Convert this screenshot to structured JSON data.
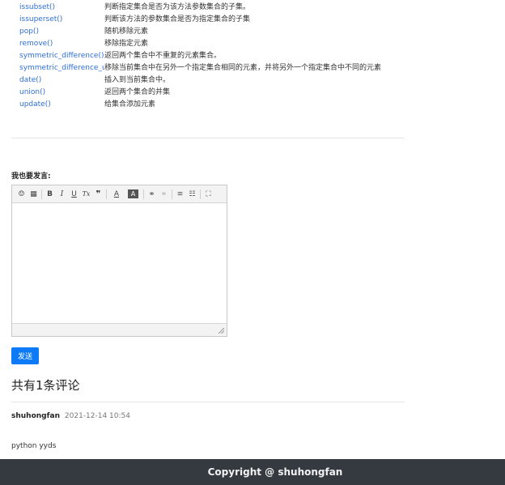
{
  "methods": [
    {
      "name": "issubset()",
      "desc": "判断指定集合是否为该方法参数集合的子集。"
    },
    {
      "name": "issuperset()",
      "desc": "判断该方法的参数集合是否为指定集合的子集"
    },
    {
      "name": "pop()",
      "desc": "随机移除元素"
    },
    {
      "name": "remove()",
      "desc": "移除指定元素"
    },
    {
      "name": "symmetric_difference()",
      "desc": "返回两个集合中不重复的元素集合。"
    },
    {
      "name": "symmetric_difference_update()",
      "desc": "移除当前集合中在另外一个指定集合相同的元素，并将另外一个指定集合中不同的元素"
    },
    {
      "name": "date()",
      "desc": "插入到当前集合中。"
    },
    {
      "name": "union()",
      "desc": "返回两个集合的并集"
    },
    {
      "name": "update()",
      "desc": "给集合添加元素"
    }
  ],
  "comment_form": {
    "label": "我也要发言:",
    "send_label": "发送"
  },
  "toolbar_icons": {
    "emoji": "☺",
    "code": "▦",
    "bold": "B",
    "italic": "I",
    "underline": "U",
    "clear_format": "Tx",
    "quote": "❞",
    "font_color": "A",
    "bg_color": "A",
    "link": "⚭",
    "unlink": "⚭",
    "ordered_list": "≡",
    "unordered_list": "☷",
    "fullscreen": "⛶"
  },
  "comments": {
    "count_label": "共有1条评论",
    "items": [
      {
        "user": "shuhongfan",
        "time": "2021-12-14 10:54",
        "body": "python yyds"
      }
    ]
  },
  "footer": {
    "text": "Copyright @ shuhongfan"
  },
  "colors": {
    "link": "#2f6fd8",
    "button": "#0d7bf7",
    "footer_bg": "#343a40"
  }
}
